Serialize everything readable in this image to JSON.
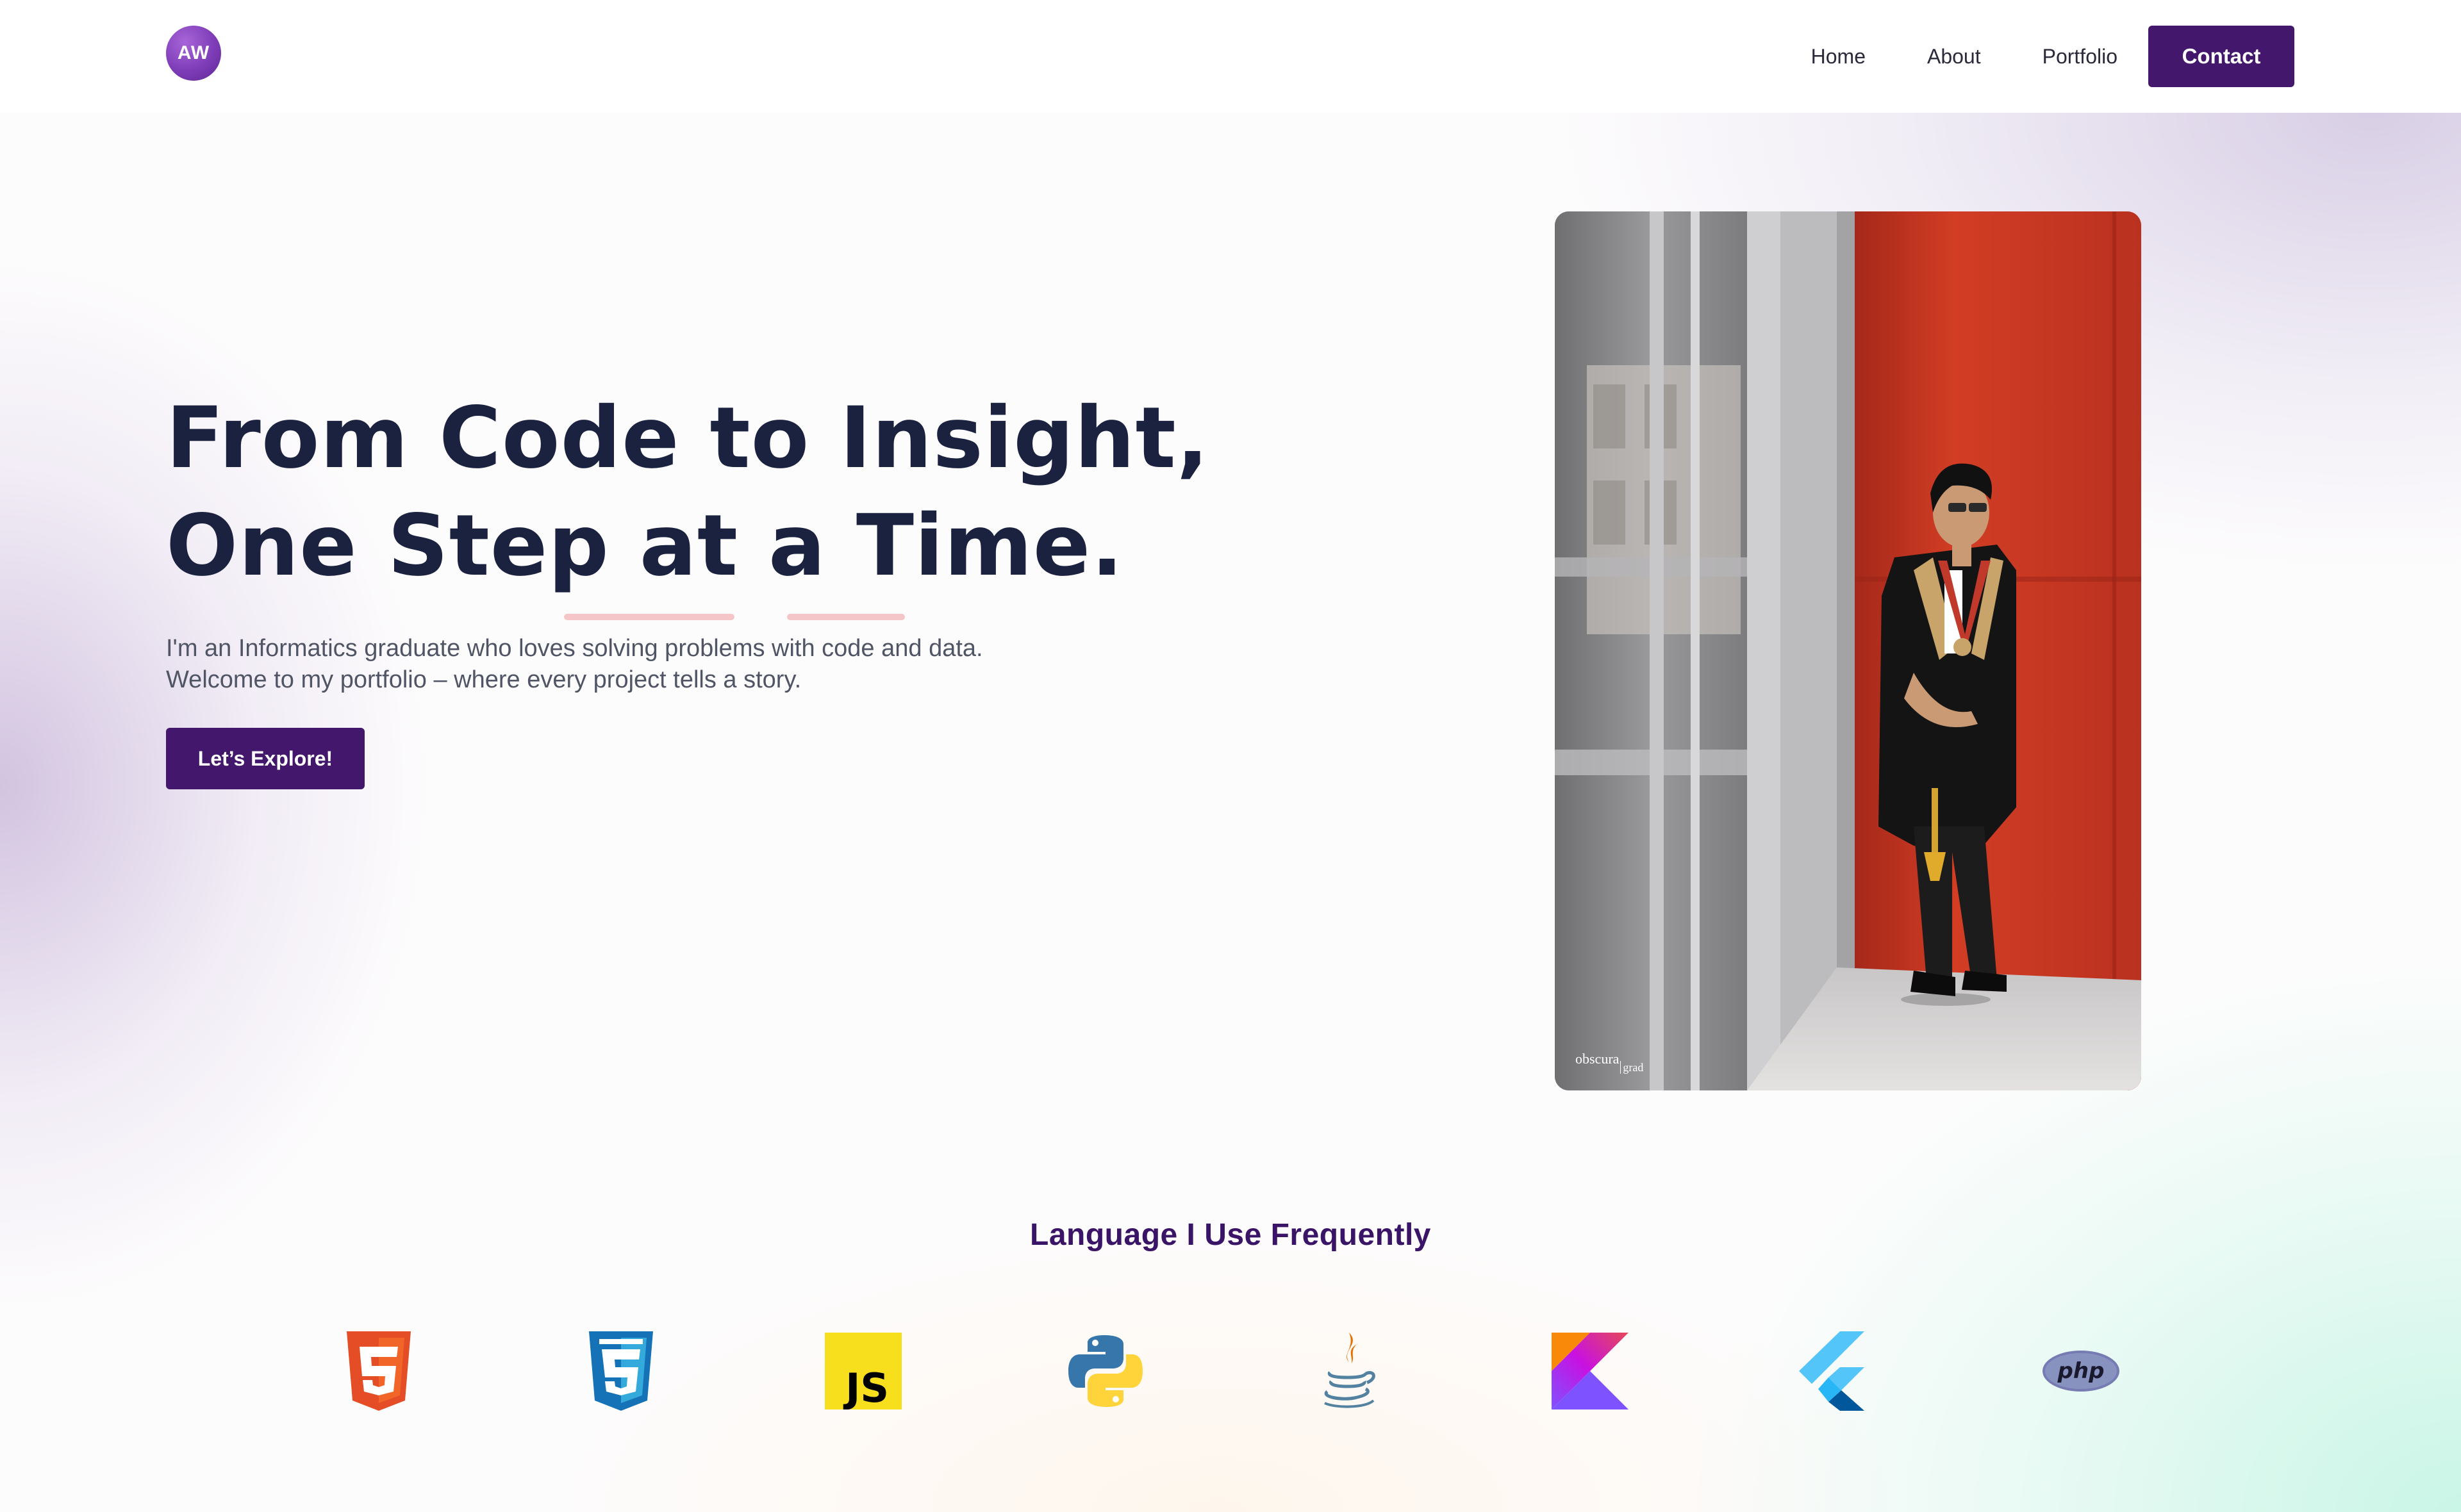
{
  "brand": {
    "logo_text": "AW",
    "accent_color": "#43186c"
  },
  "nav": {
    "items": [
      {
        "label": "Home"
      },
      {
        "label": "About"
      },
      {
        "label": "Portfolio"
      }
    ],
    "contact_label": "Contact"
  },
  "hero": {
    "title_line1": "From Code to Insight,",
    "title_line2": "One Step at a Time.",
    "desc_line1": "I'm an Informatics graduate who loves solving problems with code and data.",
    "desc_line2": "Welcome to my portfolio – where every project tells a story.",
    "cta_label": "Let’s Explore!"
  },
  "photo": {
    "watermark_main": "obscura",
    "watermark_sub": "grad"
  },
  "languages": {
    "title": "Language I Use Frequently",
    "icons": [
      {
        "name": "html5-icon"
      },
      {
        "name": "css3-icon"
      },
      {
        "name": "javascript-icon",
        "text": "JS"
      },
      {
        "name": "python-icon"
      },
      {
        "name": "java-icon"
      },
      {
        "name": "kotlin-icon"
      },
      {
        "name": "flutter-icon"
      },
      {
        "name": "php-icon",
        "text": "php"
      }
    ]
  }
}
